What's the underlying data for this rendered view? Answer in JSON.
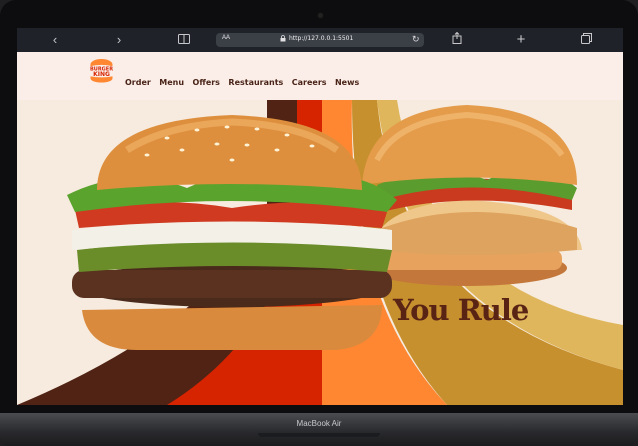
{
  "browser": {
    "url_prefix": "AA",
    "url": "http://127.0.0.1:5501",
    "icons": [
      "back-icon",
      "forward-icon",
      "book-icon",
      "share-icon",
      "plus-icon",
      "tabs-icon"
    ]
  },
  "site": {
    "brand": "BURGER KING",
    "brand_line1": "BURGER",
    "brand_line2": "KING",
    "nav": [
      "Order",
      "Menu",
      "Offers",
      "Restaurants",
      "Careers",
      "News"
    ],
    "tagline": "You Rule",
    "colors": {
      "nav_bg": "#fbeee8",
      "brand_brown": "#502314",
      "brand_orange": "#ff8732",
      "brand_red": "#d62300"
    }
  },
  "device": {
    "label": "MacBook Air"
  }
}
